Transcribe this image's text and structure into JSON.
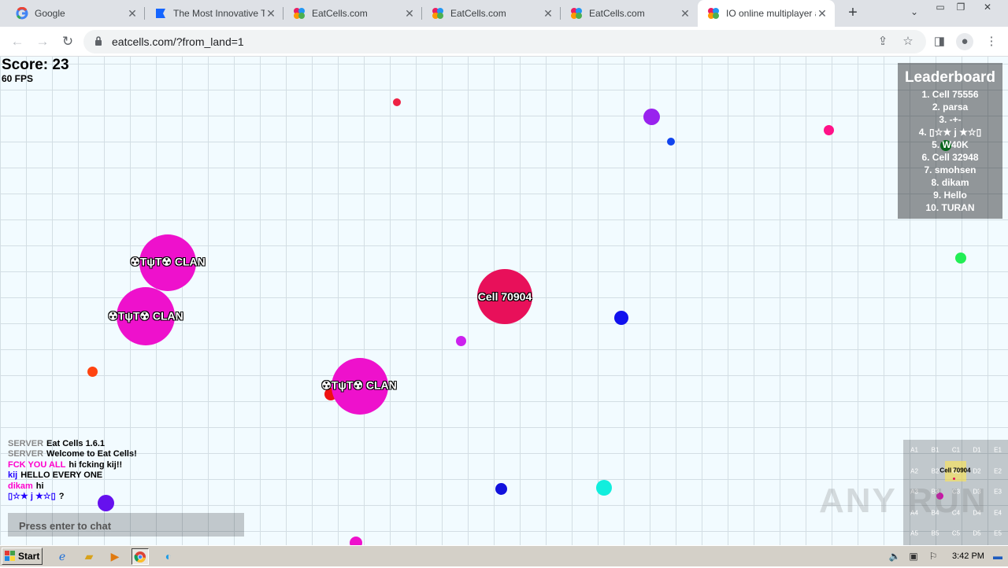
{
  "browser": {
    "tabs": [
      {
        "title": "Google",
        "favicon": "google-icon"
      },
      {
        "title": "The Most Innovative Tr",
        "favicon": "blue-flag-icon"
      },
      {
        "title": "EatCells.com",
        "favicon": "eatcells-icon"
      },
      {
        "title": "EatCells.com",
        "favicon": "eatcells-icon"
      },
      {
        "title": "EatCells.com",
        "favicon": "eatcells-icon"
      },
      {
        "title": "IO online multiplayer ar",
        "favicon": "eatcells-icon",
        "active": true
      }
    ],
    "new_tab_label": "+",
    "url": "eatcells.com/?from_land=1"
  },
  "game": {
    "score_text": "Score: 23",
    "fps_text": "60 FPS",
    "cell_names": {
      "player": "Cell 70904",
      "clan1": "☢TψT☢ CLAN",
      "clan2": "☢TψT☢ CLAN",
      "clan3": "☢TψT☢ CLAN"
    },
    "colors": {
      "player": "#e8105a",
      "clan": "#ee11cc"
    },
    "leaderboard": {
      "title": "Leaderboard",
      "entries": [
        "1. Cell 75556",
        "2. parsa",
        "3. -+-",
        "4. ▯☆★ j ★☆▯",
        "5. W40K",
        "6. Cell 32948",
        "7. smohsen",
        "8. dikam",
        "9. Hello",
        "10. TURAN"
      ]
    },
    "chat": [
      {
        "who": "SERVER",
        "who_color": "#888888",
        "msg": "Eat Cells 1.6.1"
      },
      {
        "who": "SERVER",
        "who_color": "#888888",
        "msg": "Welcome to Eat Cells!"
      },
      {
        "who": "FCK YOU ALL",
        "who_color": "#ff00cc",
        "msg": "hi fcking kij!!"
      },
      {
        "who": "kij",
        "who_color": "#2200ff",
        "msg": "HELLO EVERY ONE"
      },
      {
        "who": "dikam",
        "who_color": "#ff00cc",
        "msg": "hi"
      },
      {
        "who": "▯☆★ j ★☆▯",
        "who_color": "#2200ff",
        "msg": "?"
      }
    ],
    "chat_placeholder": "Press enter to chat",
    "minimap": {
      "rows": [
        [
          "A1",
          "B1",
          "C1",
          "D1",
          "E1"
        ],
        [
          "A2",
          "B2",
          "C2",
          "D2",
          "E2"
        ],
        [
          "A3",
          "B3",
          "C3",
          "D3",
          "E3"
        ],
        [
          "A4",
          "B4",
          "C4",
          "D4",
          "E4"
        ],
        [
          "A5",
          "B5",
          "C5",
          "D5",
          "E5"
        ]
      ],
      "player_label": "Cell 70904"
    },
    "watermark": "ANY RUN"
  },
  "taskbar": {
    "start_label": "Start",
    "clock": "3:42 PM"
  }
}
